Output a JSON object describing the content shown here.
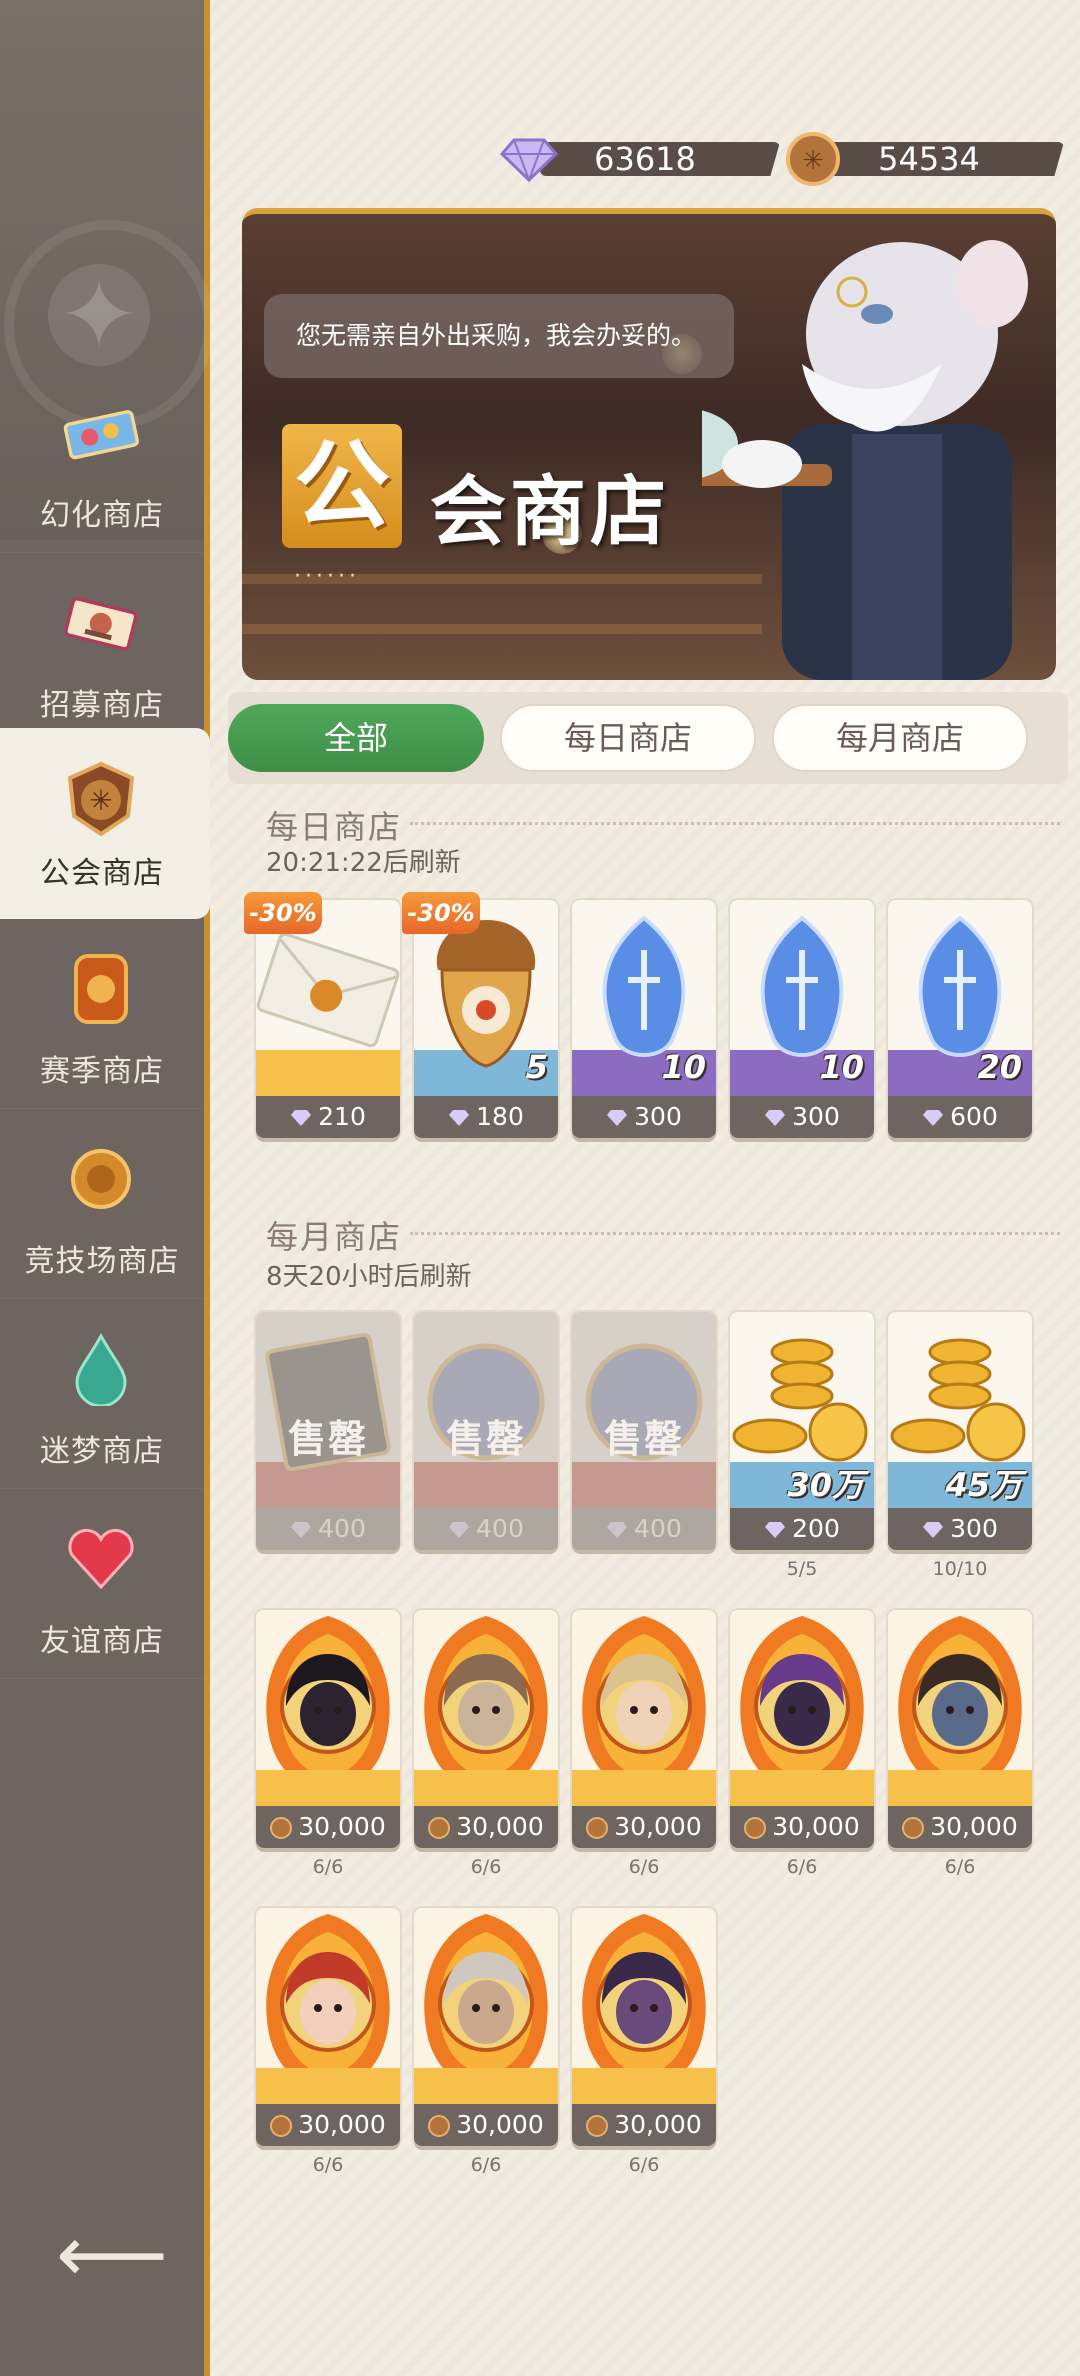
{
  "sidebar": {
    "items": [
      {
        "label": "幻化商店",
        "icon": "ticket-icon"
      },
      {
        "label": "招募商店",
        "icon": "recruit-scroll-icon"
      },
      {
        "label": "公会商店",
        "icon": "guild-emblem-icon",
        "active": true
      },
      {
        "label": "赛季商店",
        "icon": "season-badge-icon"
      },
      {
        "label": "竞技场商店",
        "icon": "arena-coin-icon"
      },
      {
        "label": "迷梦商店",
        "icon": "dream-drop-icon"
      },
      {
        "label": "友谊商店",
        "icon": "heart-gem-icon"
      }
    ],
    "back_icon": "back-arrow-icon"
  },
  "currency": {
    "diamonds": "63618",
    "guild_coins": "54534",
    "colors": {
      "accent_gold": "#c8922c",
      "bar": "#5a4c46"
    }
  },
  "banner": {
    "speech": "您无需亲自外出采购，我会办妥的。",
    "title_first_char": "公",
    "title_rest": "会商店",
    "dots": "······"
  },
  "tabs": [
    {
      "label": "全部",
      "active": true
    },
    {
      "label": "每日商店"
    },
    {
      "label": "每月商店"
    }
  ],
  "daily": {
    "title": "每日商店",
    "refresh": "20:21:22后刷新",
    "items": [
      {
        "name": "envelope",
        "price": "210",
        "discount": "-30%",
        "qty": ""
      },
      {
        "name": "acorn-badge",
        "price": "180",
        "discount": "-30%",
        "qty": "5"
      },
      {
        "name": "blue-crystal",
        "price": "300",
        "discount": "",
        "qty": "10"
      },
      {
        "name": "blue-crystal",
        "price": "300",
        "discount": "",
        "qty": "10"
      },
      {
        "name": "blue-crystal",
        "price": "600",
        "discount": "",
        "qty": "20"
      }
    ]
  },
  "monthly": {
    "title": "每月商店",
    "refresh": "8天20小时后刷新",
    "sold_out_label": "售罄",
    "row1": [
      {
        "name": "sold-card",
        "price": "400",
        "sold": true
      },
      {
        "name": "sold-orb",
        "price": "400",
        "sold": true
      },
      {
        "name": "sold-orb",
        "price": "400",
        "sold": true
      },
      {
        "name": "gold-coins",
        "price": "200",
        "qty": "30万",
        "limit": "5/5"
      },
      {
        "name": "gold-coins",
        "price": "300",
        "qty": "45万",
        "limit": "10/10"
      }
    ],
    "hero_price": "30,000",
    "hero_limit": "6/6",
    "heroes": [
      {
        "name": "dark-blob",
        "face": "#2b2430",
        "hair": "#1d1820"
      },
      {
        "name": "skull-beast",
        "face": "#c9b49a",
        "hair": "#8a6b52"
      },
      {
        "name": "blond-elf",
        "face": "#f0d2b8",
        "hair": "#d9c290"
      },
      {
        "name": "masked-dark",
        "face": "#3a2a4a",
        "hair": "#6a3a8a"
      },
      {
        "name": "blue-demon",
        "face": "#5a6a8a",
        "hair": "#3a2a24"
      },
      {
        "name": "red-hair-lady",
        "face": "#f2d0bc",
        "hair": "#c23b2a"
      },
      {
        "name": "old-warrior",
        "face": "#c9a88e",
        "hair": "#cfc8c0"
      },
      {
        "name": "purple-demon",
        "face": "#6a4a7a",
        "hair": "#3a2848"
      }
    ]
  }
}
